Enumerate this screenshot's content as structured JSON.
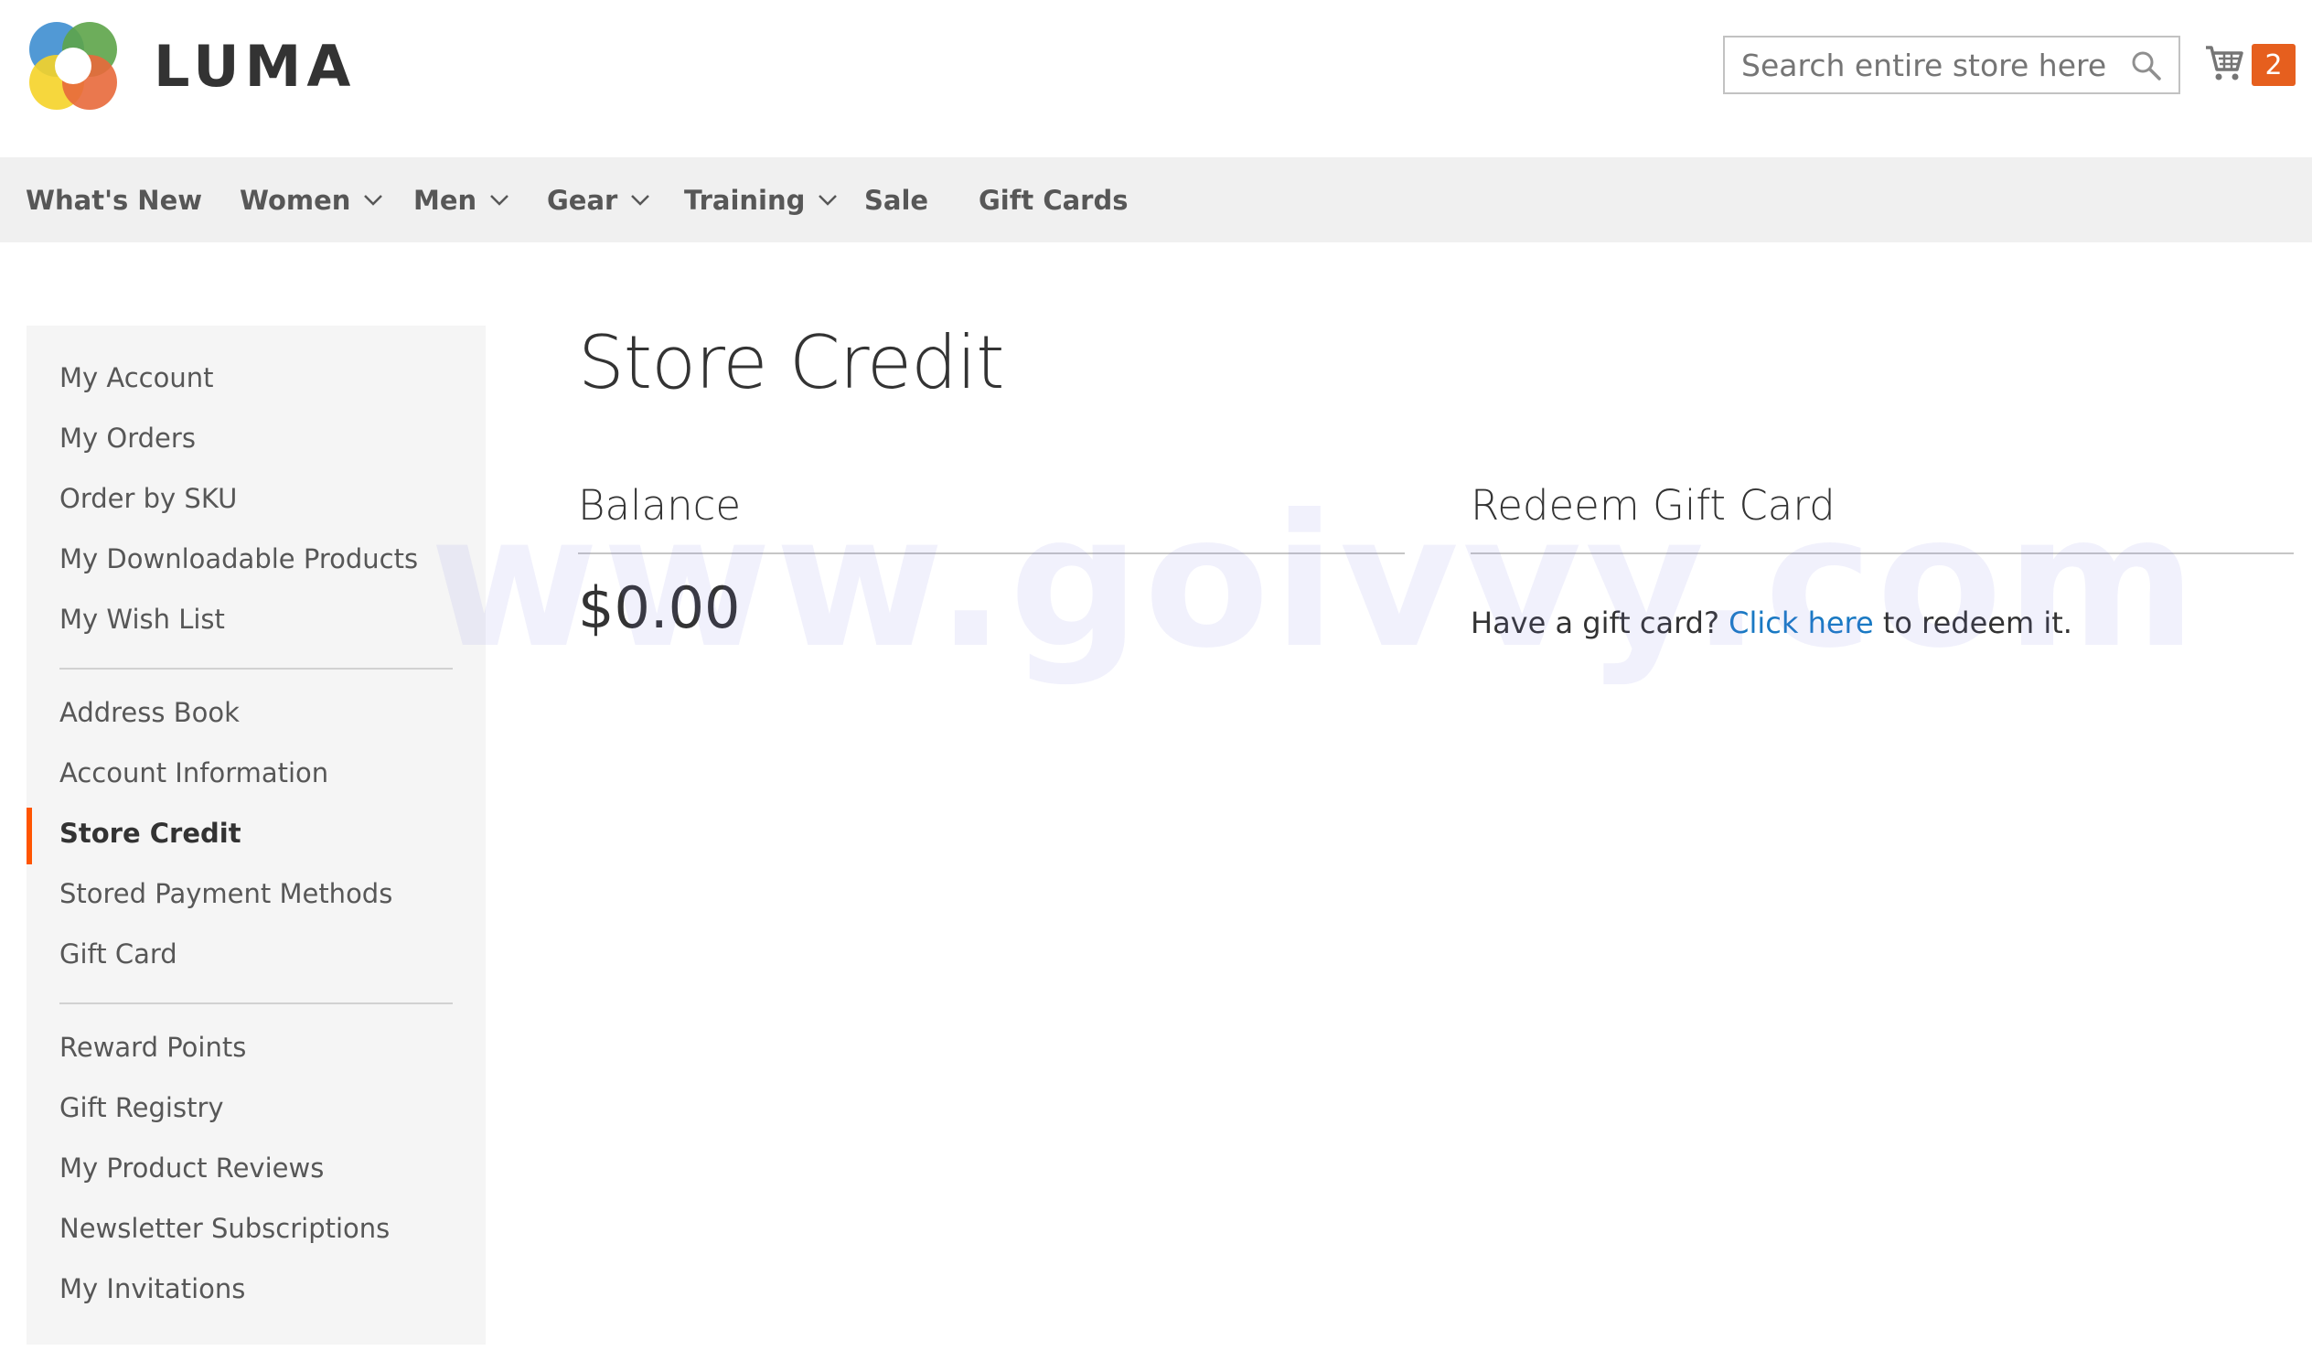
{
  "header": {
    "logo_text": "LUMA",
    "search_placeholder": "Search entire store here...",
    "cart_count": "2"
  },
  "nav": {
    "items": [
      {
        "label": "What's New",
        "has_dropdown": false
      },
      {
        "label": "Women",
        "has_dropdown": true
      },
      {
        "label": "Men",
        "has_dropdown": true
      },
      {
        "label": "Gear",
        "has_dropdown": true
      },
      {
        "label": "Training",
        "has_dropdown": true
      },
      {
        "label": "Sale",
        "has_dropdown": false
      },
      {
        "label": "Gift Cards",
        "has_dropdown": false
      }
    ]
  },
  "sidebar": {
    "groups": [
      [
        "My Account",
        "My Orders",
        "Order by SKU",
        "My Downloadable Products",
        "My Wish List"
      ],
      [
        "Address Book",
        "Account Information",
        "Store Credit",
        "Stored Payment Methods",
        "Gift Card"
      ],
      [
        "Reward Points",
        "Gift Registry",
        "My Product Reviews",
        "Newsletter Subscriptions",
        "My Invitations"
      ]
    ],
    "active_item": "Store Credit"
  },
  "main": {
    "page_title": "Store Credit",
    "balance_title": "Balance",
    "balance_value": "$0.00",
    "redeem_title": "Redeem Gift Card",
    "redeem_prefix": "Have a gift card? ",
    "redeem_link": "Click here",
    "redeem_suffix": " to redeem it."
  },
  "watermark": "www.goivvy.com",
  "colors": {
    "accent": "#ff5501",
    "link": "#1979c3",
    "badge": "#e65f1e",
    "nav_bg": "#f0f0f0",
    "sidebar_bg": "#f5f5f5"
  }
}
